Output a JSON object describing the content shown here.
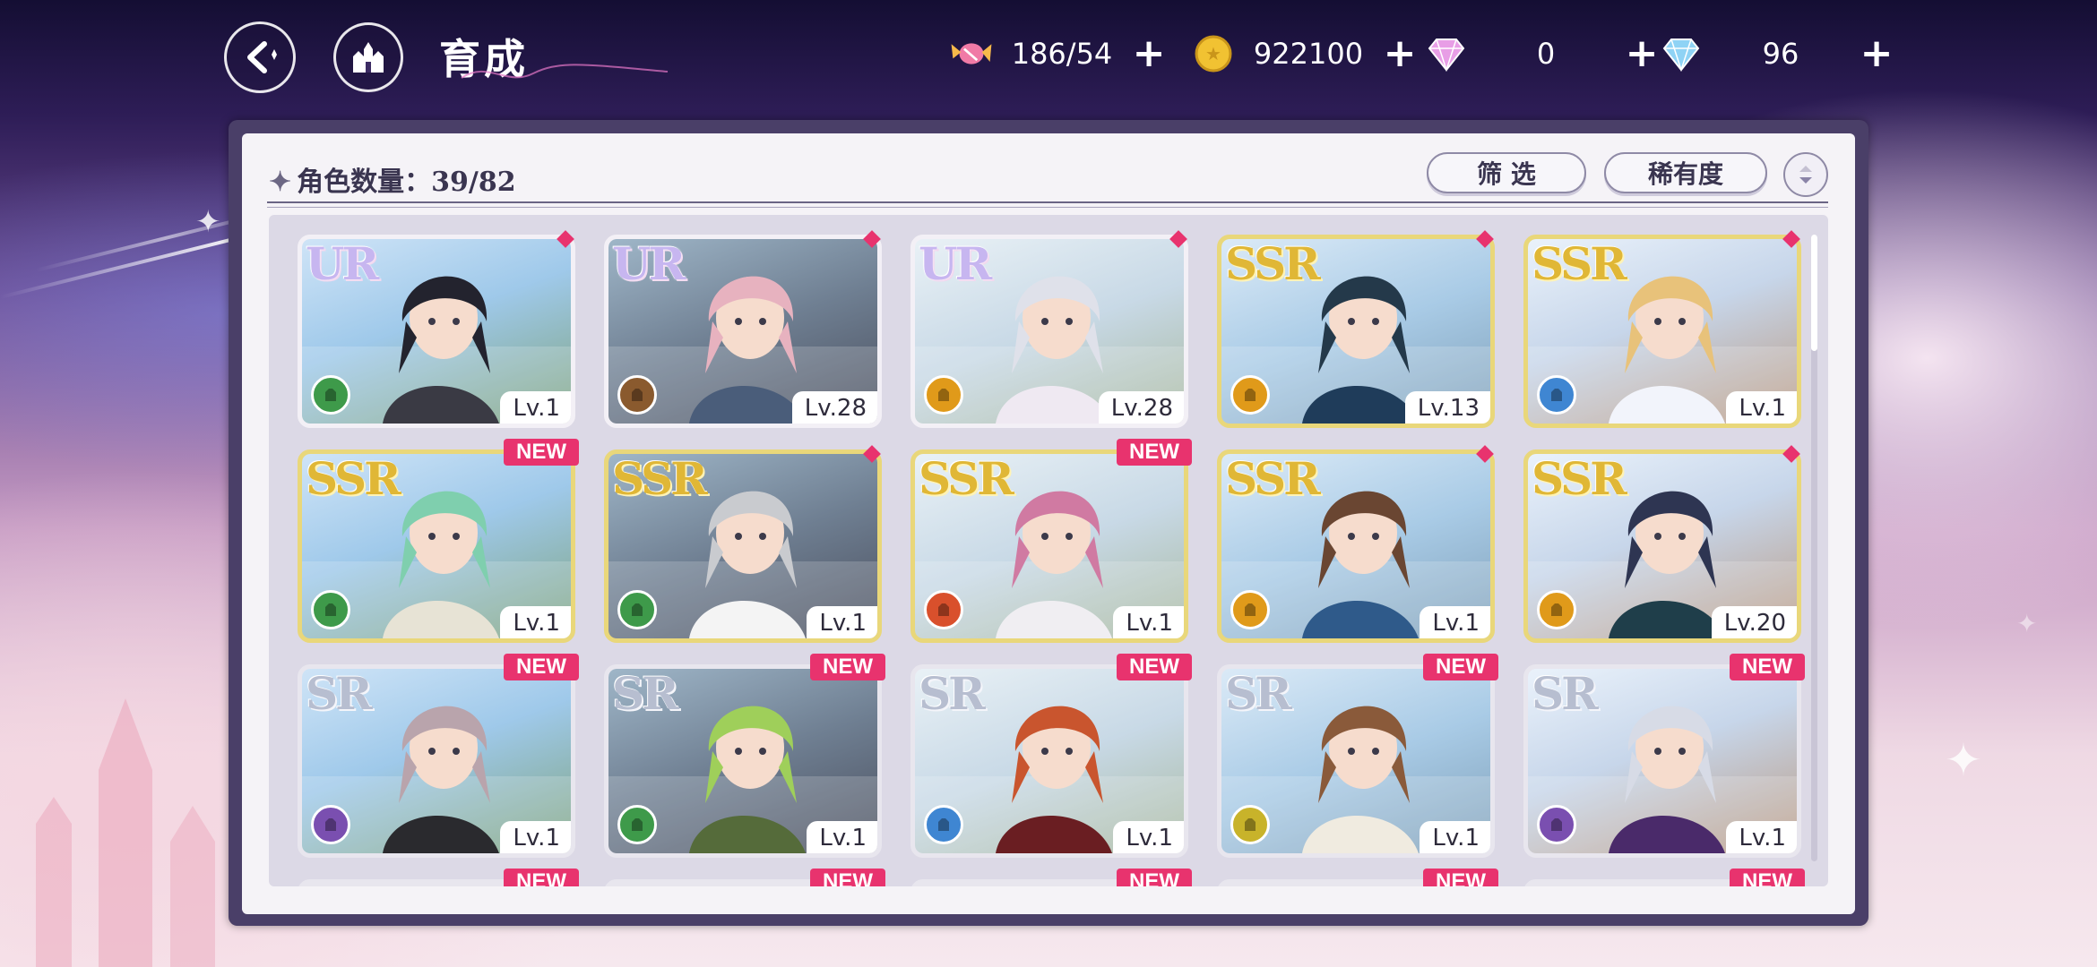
{
  "header": {
    "title": "育成"
  },
  "resources": [
    {
      "icon": "candy-icon",
      "value": "186/54"
    },
    {
      "icon": "gold-coin-icon",
      "value": "922100"
    },
    {
      "icon": "pink-gem-icon",
      "value": "0"
    },
    {
      "icon": "blue-diamond-icon",
      "value": "96"
    }
  ],
  "panel": {
    "count_label": "角色数量：39/82",
    "filter_label": "筛 选",
    "rarity_label": "稀有度"
  },
  "cards": [
    {
      "rarity": "UR",
      "level": "Lv.1",
      "role_color": "#3e9a4a",
      "new": false
    },
    {
      "rarity": "UR",
      "level": "Lv.28",
      "role_color": "#8a5a2e",
      "new": false
    },
    {
      "rarity": "UR",
      "level": "Lv.28",
      "role_color": "#e09a1a",
      "new": false
    },
    {
      "rarity": "SSR",
      "level": "Lv.13",
      "role_color": "#e09a1a",
      "new": false
    },
    {
      "rarity": "SSR",
      "level": "Lv.1",
      "role_color": "#3f86d2",
      "new": false
    },
    {
      "rarity": "SSR",
      "level": "Lv.1",
      "role_color": "#3e9a4a",
      "new": true
    },
    {
      "rarity": "SSR",
      "level": "Lv.1",
      "role_color": "#3e9a4a",
      "new": false
    },
    {
      "rarity": "SSR",
      "level": "Lv.1",
      "role_color": "#d9502c",
      "new": true
    },
    {
      "rarity": "SSR",
      "level": "Lv.1",
      "role_color": "#e09a1a",
      "new": false
    },
    {
      "rarity": "SSR",
      "level": "Lv.20",
      "role_color": "#e09a1a",
      "new": false
    },
    {
      "rarity": "SR",
      "level": "Lv.1",
      "role_color": "#7a4fb0",
      "new": true
    },
    {
      "rarity": "SR",
      "level": "Lv.1",
      "role_color": "#3e9a4a",
      "new": true
    },
    {
      "rarity": "SR",
      "level": "Lv.1",
      "role_color": "#3f86d2",
      "new": true
    },
    {
      "rarity": "SR",
      "level": "Lv.1",
      "role_color": "#c8b32a",
      "new": true
    },
    {
      "rarity": "SR",
      "level": "Lv.1",
      "role_color": "#7a4fb0",
      "new": true
    }
  ],
  "new_badge_text": "NEW"
}
